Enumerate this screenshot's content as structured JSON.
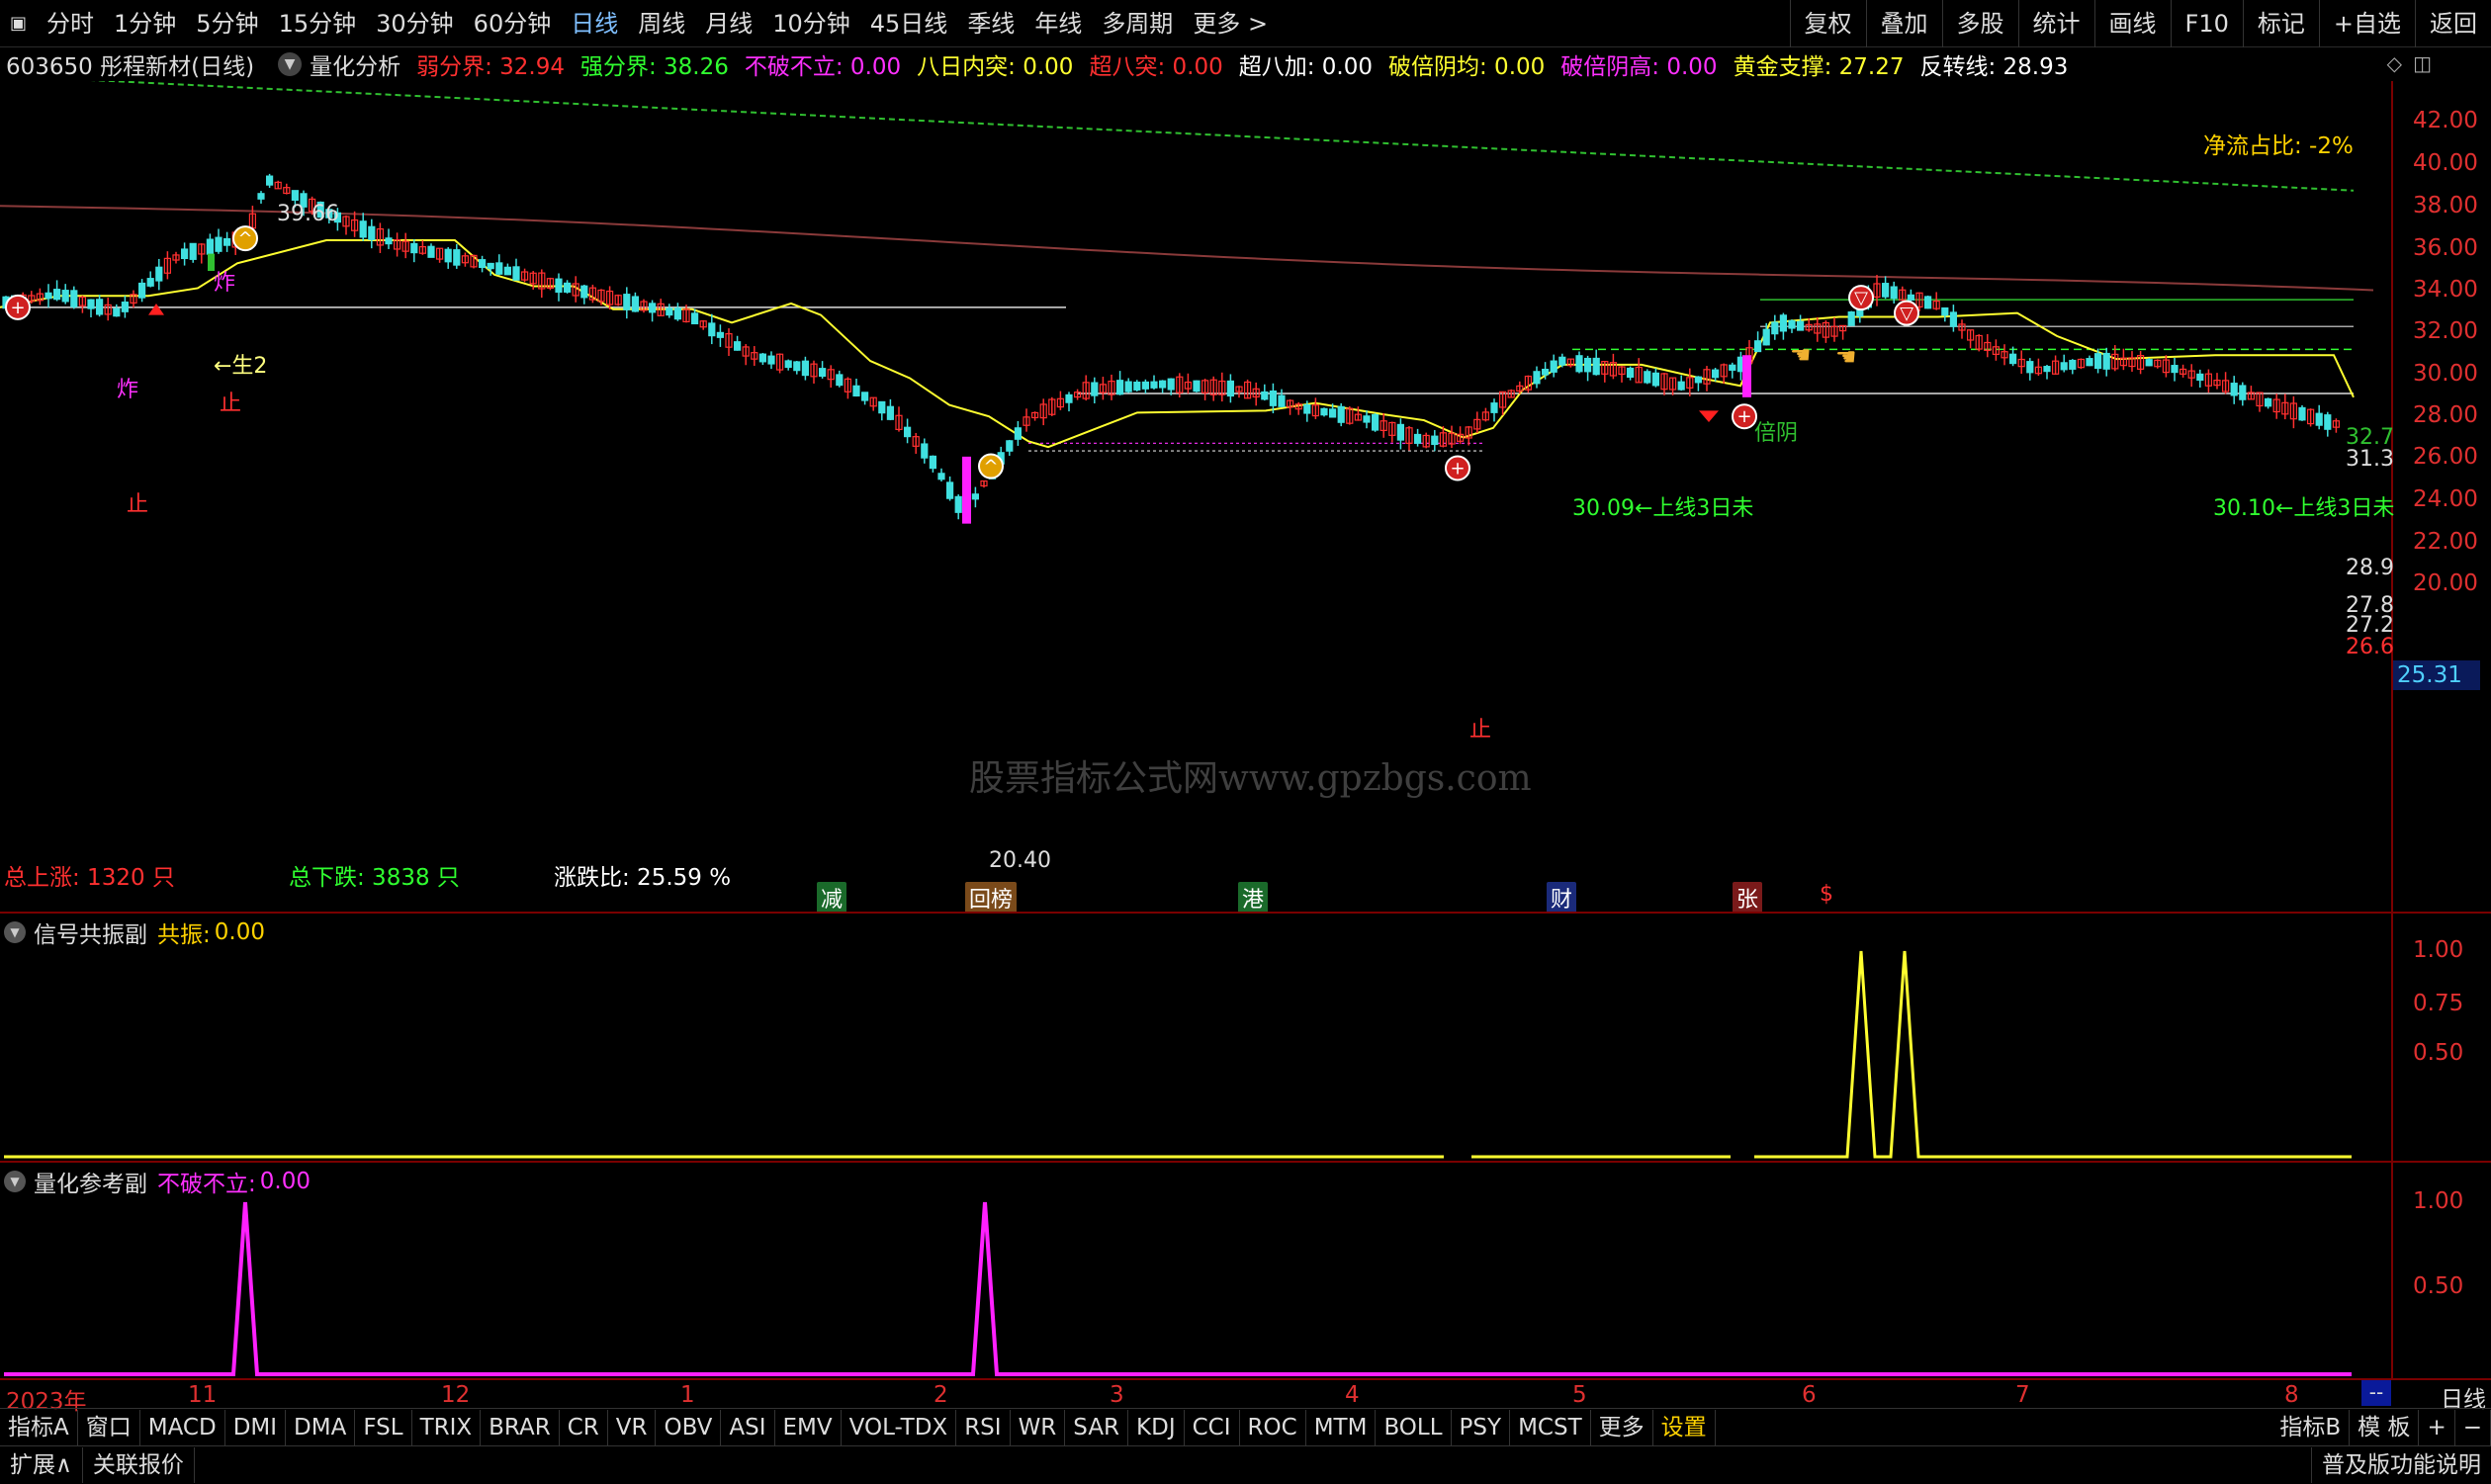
{
  "toolbar": {
    "items": [
      "分时",
      "1分钟",
      "5分钟",
      "15分钟",
      "30分钟",
      "60分钟",
      "日线",
      "周线",
      "月线",
      "10分钟",
      "45日线",
      "季线",
      "年线",
      "多周期",
      "更多 >"
    ],
    "active": "日线",
    "right_items": [
      "复权",
      "叠加",
      "多股",
      "统计",
      "画线",
      "F10",
      "标记",
      "+自选",
      "返回"
    ]
  },
  "info": {
    "stock": "603650 彤程新材(日线)",
    "indicator": "量化分析",
    "fields": [
      {
        "label": "弱分界:",
        "value": "32.94",
        "color": "#ff3030"
      },
      {
        "label": "强分界:",
        "value": "38.26",
        "color": "#30ff30"
      },
      {
        "label": "不破不立:",
        "value": "0.00",
        "color": "#ff30ff"
      },
      {
        "label": "八日内突:",
        "value": "0.00",
        "color": "#ffff30"
      },
      {
        "label": "超八突:",
        "value": "0.00",
        "color": "#ff3030"
      },
      {
        "label": "超八加:",
        "value": "0.00",
        "color": "#ffffff"
      },
      {
        "label": "破倍阴均:",
        "value": "0.00",
        "color": "#ffff30"
      },
      {
        "label": "破倍阴高:",
        "value": "0.00",
        "color": "#ff30ff"
      },
      {
        "label": "黄金支撑:",
        "value": "27.27",
        "color": "#ffff30"
      },
      {
        "label": "反转线:",
        "value": "28.93",
        "color": "#ffffff"
      }
    ]
  },
  "main": {
    "net_flow": "净流占比: -2%",
    "price_axis": [
      "42.00",
      "40.00",
      "38.00",
      "36.00",
      "34.00",
      "32.00",
      "30.00",
      "28.00",
      "26.00",
      "24.00",
      "22.00",
      "20.00"
    ],
    "current_price": "25.31",
    "high_label": "39.66",
    "low_label": "20.40",
    "stats": {
      "up": "总上涨: 1320 只",
      "down": "总下跌: 3838 只",
      "ratio": "涨跌比: 25.59 %"
    },
    "annotations": {
      "left_line": "30.09←上线3日未",
      "right_line": "30.10←上线3日未",
      "sheng": "←生2",
      "beiyin": "倍阴",
      "zha": "炸",
      "zhi": "止",
      "r1": "32.7",
      "r2": "31.3",
      "r3": "28.9",
      "r4": "27.8",
      "r5": "27.2",
      "r6": "26.6"
    },
    "news": [
      {
        "text": "减",
        "bg": "#1a6a2a",
        "color": "#ffffff"
      },
      {
        "text": "回榜",
        "bg": "#7a4a1a",
        "color": "#ffffff"
      },
      {
        "text": "港",
        "bg": "#1a6a2a",
        "color": "#ffffff"
      },
      {
        "text": "财",
        "bg": "#1a2a7a",
        "color": "#ffffff"
      },
      {
        "text": "张",
        "bg": "#7a1a1a",
        "color": "#ffffff"
      },
      {
        "text": "$",
        "bg": "#000000",
        "color": "#ff3030"
      }
    ],
    "watermark": "股票指标公式网www.gpzbgs.com"
  },
  "sub1": {
    "title": "信号共振副",
    "field_label": "共振:",
    "field_value": "0.00",
    "axis": [
      "1.00",
      "0.75",
      "0.50"
    ]
  },
  "sub2": {
    "title": "量化参考副",
    "field_label": "不破不立:",
    "field_value": "0.00",
    "axis": [
      "1.00",
      "0.50"
    ]
  },
  "dates": [
    "2023年",
    "11",
    "12",
    "1",
    "2",
    "3",
    "4",
    "5",
    "6",
    "7",
    "8"
  ],
  "date_right": "日线",
  "date_ctrl": "--",
  "indicators": [
    "指标A",
    "窗口",
    "MACD",
    "DMI",
    "DMA",
    "FSL",
    "TRIX",
    "BRAR",
    "CR",
    "VR",
    "OBV",
    "ASI",
    "EMV",
    "VOL-TDX",
    "RSI",
    "WR",
    "SAR",
    "KDJ",
    "CCI",
    "ROC",
    "MTM",
    "BOLL",
    "PSY",
    "MCST",
    "更多",
    "设置"
  ],
  "indicators_right": [
    "指标B",
    "模 板",
    "+",
    "−"
  ],
  "bottom": {
    "expand": "扩展∧",
    "linked": "关联报价",
    "right": "普及版功能说明"
  },
  "colors": {
    "up": "#ff3030",
    "down": "#40e0e0",
    "ma_long": "#8a3a3a",
    "signal": "#ffff30",
    "green_ma": "#30c030",
    "magenta": "#ff20ff"
  }
}
